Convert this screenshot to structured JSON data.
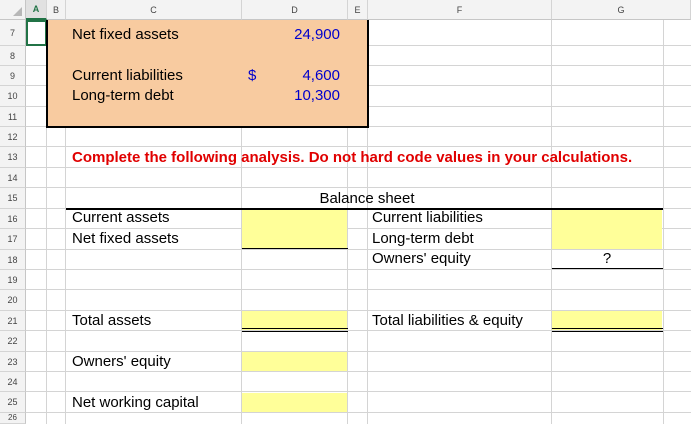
{
  "columns": [
    "A",
    "B",
    "C",
    "D",
    "E",
    "F",
    "G"
  ],
  "rows": [
    "7",
    "8",
    "9",
    "10",
    "11",
    "12",
    "13",
    "14",
    "15",
    "16",
    "17",
    "18",
    "19",
    "20",
    "21",
    "22",
    "23",
    "24",
    "25",
    "26"
  ],
  "data_box": {
    "net_fixed_assets_label": "Net fixed assets",
    "net_fixed_assets_value": "24,900",
    "current_liabilities_label": "Current liabilities",
    "currency_symbol": "$",
    "current_liabilities_value": "4,600",
    "long_term_debt_label": "Long-term debt",
    "long_term_debt_value": "10,300"
  },
  "instruction": "Complete the following analysis. Do not hard code values in your calculations.",
  "balance_sheet": {
    "title": "Balance sheet",
    "left": [
      "Current assets",
      "Net fixed assets"
    ],
    "right": [
      "Current liabilities",
      "Long-term debt",
      "Owners' equity"
    ],
    "owners_equity_value": "?",
    "total_assets_label": "Total assets",
    "total_le_label": "Total liabilities & equity"
  },
  "analysis": {
    "owners_equity_label": "Owners' equity",
    "nwc_label": "Net working capital"
  },
  "colors": {
    "box_fill": "#f8cba0",
    "input_fill": "#ffff99",
    "instruction_color": "#e00000",
    "value_color": "#0000cc"
  }
}
